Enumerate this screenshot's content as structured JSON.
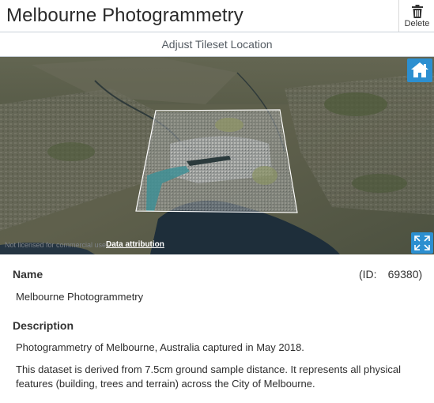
{
  "header": {
    "title": "Melbourne Photogrammetry",
    "delete_label": "Delete"
  },
  "toolbar": {
    "adjust_label": "Adjust Tileset Location"
  },
  "map": {
    "attribution_faint": "Not licensed for commercial use",
    "attribution_link": "Data attribution",
    "icons": {
      "home": "home-icon",
      "fullscreen": "fullscreen-icon"
    }
  },
  "details": {
    "name_label": "Name",
    "id_label": "(ID:",
    "id_value": "69380)",
    "name_value": "Melbourne Photogrammetry",
    "description_label": "Description",
    "description_line1": "Photogrammetry of Melbourne, Australia captured in May 2018.",
    "description_line2a": "This dataset is derived from 7.5cm ground sample distance. It represents all physical",
    "description_line2b": "features (building, trees and terrain) across the City of Melbourne."
  },
  "colors": {
    "accent": "#2c8fd0",
    "border": "#c9d1d9",
    "water_bay": "#1e2e3a",
    "tileset_outline": "#ffffff"
  }
}
